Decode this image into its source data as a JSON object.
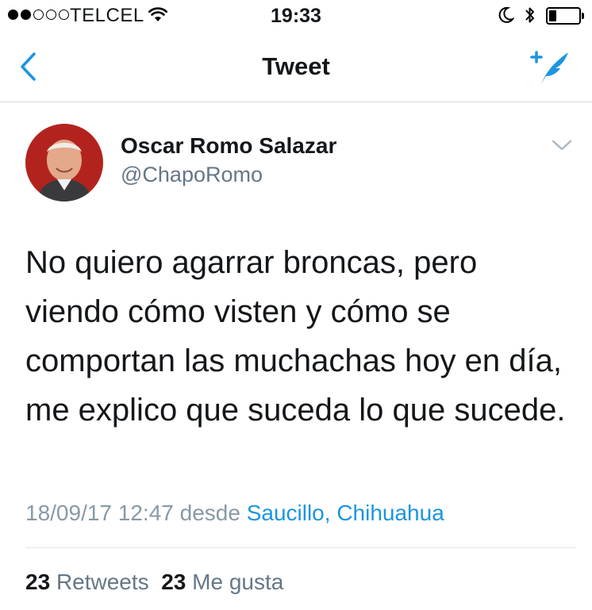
{
  "status_bar": {
    "carrier": "TELCEL",
    "time": "19:33",
    "signal_bars": 2,
    "signal_total": 5,
    "battery_level": 0.25
  },
  "nav": {
    "title": "Tweet",
    "back_icon": "chevron-left-icon",
    "compose_icon": "compose-tweet-icon"
  },
  "tweet": {
    "author_name": "Oscar Romo Salazar",
    "handle": "@ChapoRomo",
    "text": "No quiero agarrar broncas, pero viendo cómo visten y cómo se comportan las muchachas hoy en día, me explico que suceda lo que sucede.",
    "timestamp": "18/09/17 12:47",
    "from_label": "desde",
    "location": "Saucillo, Chihuahua",
    "retweets_count": "23",
    "retweets_label": "Retweets",
    "likes_count": "23",
    "likes_label": "Me gusta"
  },
  "colors": {
    "accent": "#1b95e0",
    "secondary_text": "#657786",
    "meta_text": "#8899a6",
    "avatar_bg": "#b3231e"
  }
}
